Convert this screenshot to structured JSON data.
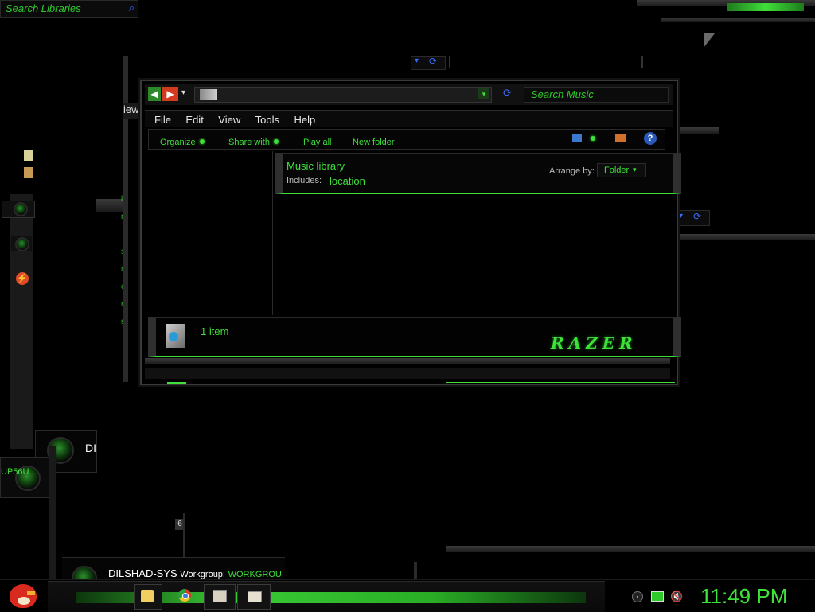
{
  "desktop": {
    "search_libraries_placeholder": "Search Libraries",
    "peek_view_label": "iew",
    "gadget_user_initials": "DI",
    "gadget_group_fragment": "UP56U...",
    "gadget_number": "6",
    "sysinfo": {
      "computer": "DILSHAD-SYS",
      "workgroup_label": "Workgroup:",
      "workgroup_value": "WORKGROU"
    }
  },
  "explorer": {
    "search_placeholder": "Search Music",
    "menu": [
      "File",
      "Edit",
      "View",
      "Tools",
      "Help"
    ],
    "commands": {
      "organize": "Organize",
      "share_with": "Share with",
      "play_all": "Play all",
      "new_folder": "New folder"
    },
    "library": {
      "title": "Music library",
      "includes_label": "Includes:",
      "includes_value": "location",
      "arrange_label": "Arrange by:",
      "arrange_value": "Folder"
    },
    "status": {
      "item_count": "1 item",
      "brand": "RAZER"
    }
  },
  "taskbar": {
    "clock": "11:49 PM",
    "colors": {
      "accent": "#3fe03a",
      "background": "#000000",
      "panel": "#1a1a1a"
    }
  }
}
